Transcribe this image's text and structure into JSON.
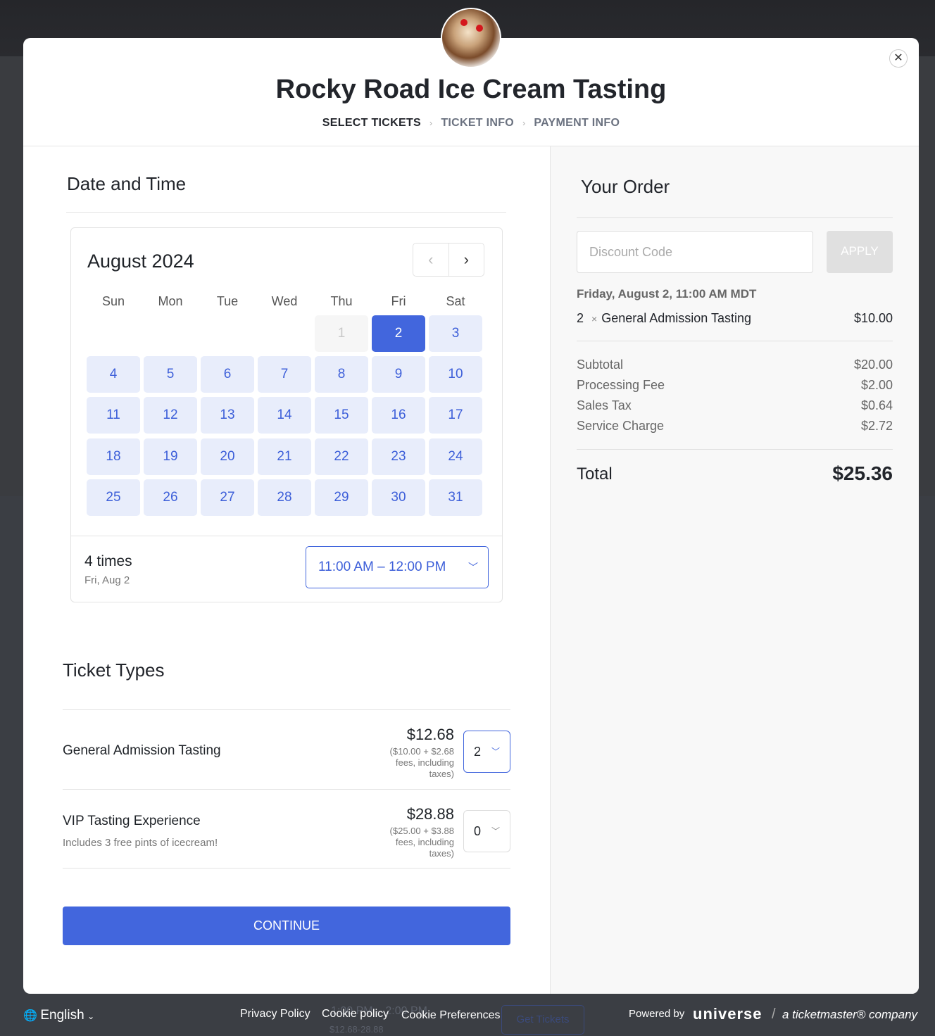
{
  "event": {
    "title": "Rocky Road Ice Cream Tasting",
    "steps": [
      "SELECT TICKETS",
      "TICKET INFO",
      "PAYMENT INFO"
    ]
  },
  "date_time": {
    "heading": "Date and Time",
    "month": "August 2024",
    "weekdays": [
      "Sun",
      "Mon",
      "Tue",
      "Wed",
      "Thu",
      "Fri",
      "Sat"
    ],
    "first_weekday_index": 4,
    "days_in_month": 31,
    "selected_day": 2,
    "disabled_days": [
      1
    ],
    "times_count": "4 times",
    "times_date": "Fri, Aug 2",
    "selected_time": "11:00 AM – 12:00 PM"
  },
  "tickets": {
    "heading": "Ticket Types",
    "items": [
      {
        "name": "General Admission Tasting",
        "description": "",
        "price": "$12.68",
        "fees": "($10.00 + $2.68 fees, including taxes)",
        "quantity": "2"
      },
      {
        "name": "VIP Tasting Experience",
        "description": "Includes 3 free pints of icecream!",
        "price": "$28.88",
        "fees": "($25.00 + $3.88 fees, including taxes)",
        "quantity": "0"
      }
    ],
    "continue_label": "CONTINUE"
  },
  "order": {
    "heading": "Your Order",
    "discount_placeholder": "Discount Code",
    "apply_label": "APPLY",
    "date": "Friday, August 2, 11:00 AM MDT",
    "line": {
      "qty": "2",
      "x": "×",
      "name": "General Admission Tasting",
      "price": "$10.00"
    },
    "summary": [
      {
        "label": "Subtotal",
        "value": "$20.00"
      },
      {
        "label": "Processing Fee",
        "value": "$2.00"
      },
      {
        "label": "Sales Tax",
        "value": "$0.64"
      },
      {
        "label": "Service Charge",
        "value": "$2.72"
      }
    ],
    "total_label": "Total",
    "total": "$25.36"
  },
  "footer": {
    "language": "English",
    "links": [
      "Privacy Policy",
      "Cookie policy",
      "Cookie Preferences"
    ],
    "powered_by": "Powered by",
    "brand": "universe",
    "tm": "a ticketmaster® company"
  },
  "background": {
    "time": "1:00 PM – 2:00 PM",
    "range": "$12.68-28.88",
    "button": "Get Tickets"
  },
  "colors": {
    "accent": "#4266dd",
    "day_bg": "#e8edfb"
  }
}
